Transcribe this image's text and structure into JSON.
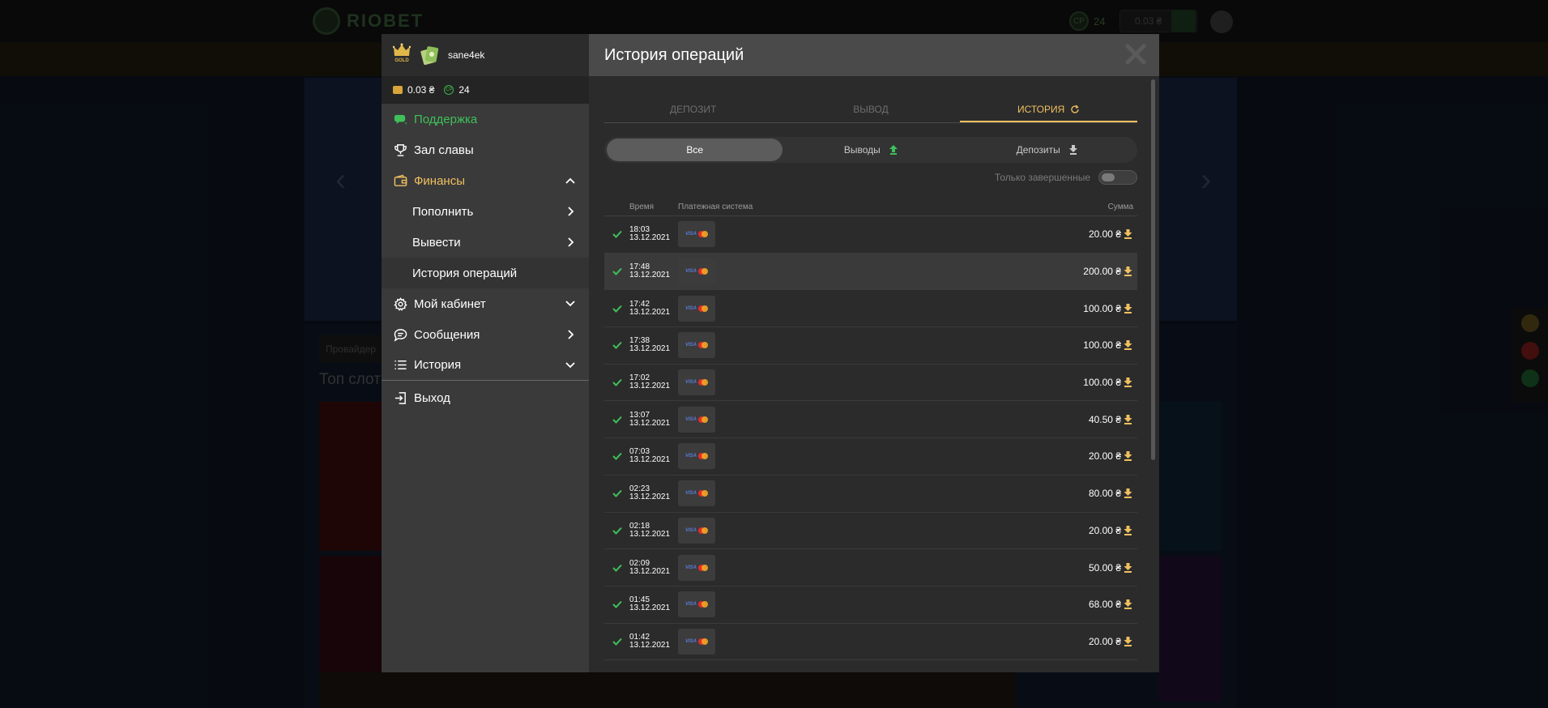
{
  "background": {
    "logo_text": "RIOBET",
    "cp_label": "CP",
    "cp_count": "24",
    "balance": "0.03 ₴",
    "provider_label": "Провайдер",
    "top_slots": "Топ слот"
  },
  "user": {
    "level": "GOLD",
    "name": "sane4ek",
    "balance": "0.03 ₴",
    "cp_label": "CP",
    "cp": "24"
  },
  "menu": {
    "support": "Поддержка",
    "hall_of_fame": "Зал славы",
    "finance": "Финансы",
    "deposit": "Пополнить",
    "withdraw": "Вывести",
    "history_ops": "История операций",
    "cabinet": "Мой кабинет",
    "messages": "Сообщения",
    "history": "История",
    "logout": "Выход"
  },
  "modal": {
    "title": "История операций",
    "tabs": [
      "ДЕПОЗИТ",
      "ВЫВОД",
      "ИСТОРИЯ"
    ],
    "filters": [
      "Все",
      "Выводы",
      "Депозиты"
    ],
    "only_completed": "Только завершенные",
    "columns": {
      "time": "Время",
      "payment": "Платежная система",
      "sum": "Сумма"
    },
    "payment_logo_text": "VISA"
  },
  "transactions": [
    {
      "time": "18:03",
      "date": "13.12.2021",
      "amount": "20.00 ₴"
    },
    {
      "time": "17:48",
      "date": "13.12.2021",
      "amount": "200.00 ₴"
    },
    {
      "time": "17:42",
      "date": "13.12.2021",
      "amount": "100.00 ₴"
    },
    {
      "time": "17:38",
      "date": "13.12.2021",
      "amount": "100.00 ₴"
    },
    {
      "time": "17:02",
      "date": "13.12.2021",
      "amount": "100.00 ₴"
    },
    {
      "time": "13:07",
      "date": "13.12.2021",
      "amount": "40.50 ₴"
    },
    {
      "time": "07:03",
      "date": "13.12.2021",
      "amount": "20.00 ₴"
    },
    {
      "time": "02:23",
      "date": "13.12.2021",
      "amount": "80.00 ₴"
    },
    {
      "time": "02:18",
      "date": "13.12.2021",
      "amount": "20.00 ₴"
    },
    {
      "time": "02:09",
      "date": "13.12.2021",
      "amount": "50.00 ₴"
    },
    {
      "time": "01:45",
      "date": "13.12.2021",
      "amount": "68.00 ₴"
    },
    {
      "time": "01:42",
      "date": "13.12.2021",
      "amount": "20.00 ₴"
    }
  ],
  "colors": {
    "accent_gold": "#f0c060",
    "success_green": "#3fbf5a",
    "panel_dark": "#2b2b2b"
  }
}
